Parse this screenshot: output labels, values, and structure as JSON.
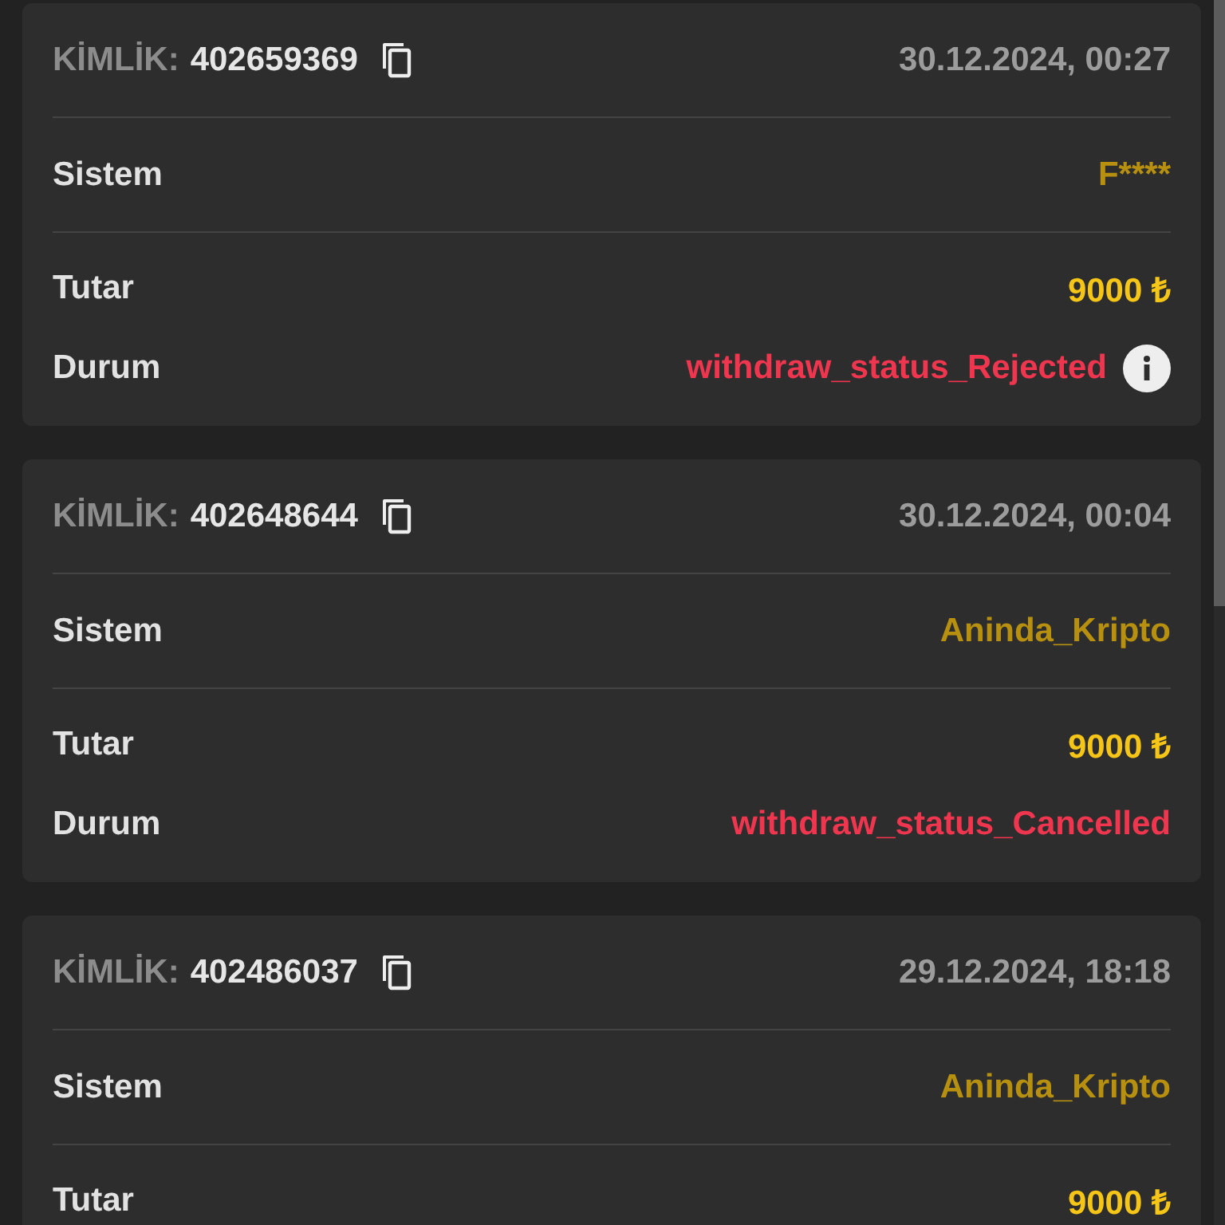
{
  "transactions": [
    {
      "id_label": "KİMLİK:",
      "id": "402659369",
      "date": "30.12.2024, 00:27",
      "system": {
        "label": "Sistem",
        "value": "F****"
      },
      "amount": {
        "label": "Tutar",
        "value": "9000 ₺"
      },
      "status": {
        "label": "Durum",
        "value": "withdraw_status_Rejected",
        "info": true
      }
    },
    {
      "id_label": "KİMLİK:",
      "id": "402648644",
      "date": "30.12.2024, 00:04",
      "system": {
        "label": "Sistem",
        "value": "Aninda_Kripto"
      },
      "amount": {
        "label": "Tutar",
        "value": "9000 ₺"
      },
      "status": {
        "label": "Durum",
        "value": "withdraw_status_Cancelled",
        "info": false
      }
    },
    {
      "id_label": "KİMLİK:",
      "id": "402486037",
      "date": "29.12.2024, 18:18",
      "system": {
        "label": "Sistem",
        "value": "Aninda_Kripto"
      },
      "amount": {
        "label": "Tutar",
        "value": "9000 ₺"
      }
    }
  ]
}
